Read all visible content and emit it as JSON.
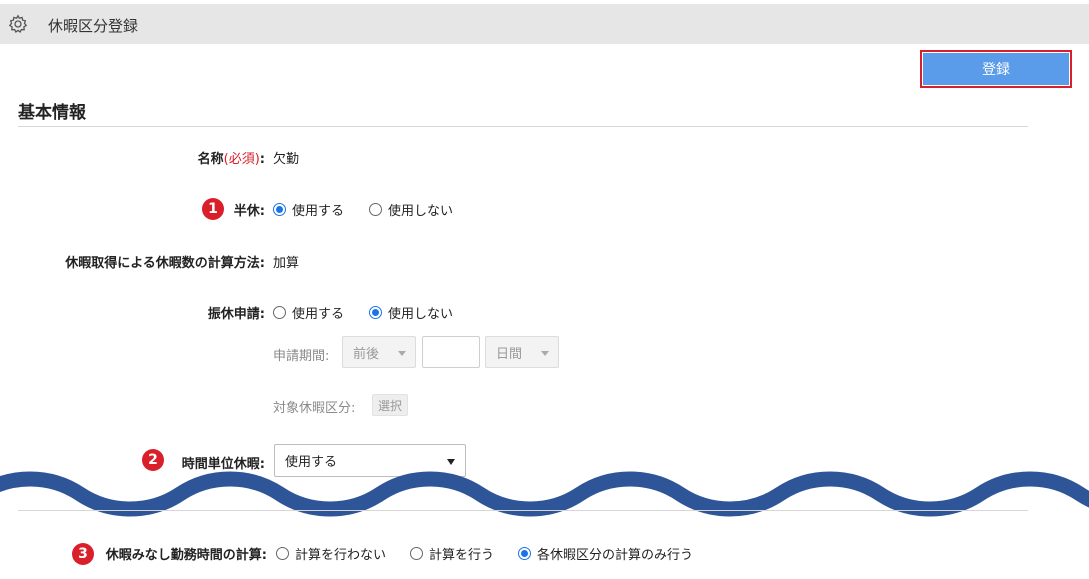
{
  "window": {
    "title": "休暇区分登録",
    "icon": "gear-icon"
  },
  "toolbar": {
    "register_label": "登録"
  },
  "section": {
    "title": "基本情報"
  },
  "fields": {
    "name": {
      "label": "名称",
      "required": "(必須)",
      "colon": ":",
      "value": "欠勤"
    },
    "half_day": {
      "badge": "1",
      "label": "半休:",
      "options": [
        {
          "label": "使用する",
          "selected": true
        },
        {
          "label": "使用しない",
          "selected": false
        }
      ]
    },
    "calc_method": {
      "label": "休暇取得による休暇数の計算方法:",
      "value": "加算"
    },
    "substitute": {
      "label": "振休申請:",
      "options": [
        {
          "label": "使用する",
          "selected": false
        },
        {
          "label": "使用しない",
          "selected": true
        }
      ],
      "period_label": "申請期間:",
      "period_select": "前後",
      "period_number": "",
      "period_unit": "日間",
      "target_label": "対象休暇区分:",
      "target_button": "選択"
    },
    "hourly": {
      "badge": "2",
      "label": "時間単位休暇:",
      "value": "使用する"
    },
    "deemed": {
      "badge": "3",
      "label": "休暇みなし勤務時間の計算:",
      "options": [
        {
          "label": "計算を行わない",
          "selected": false
        },
        {
          "label": "計算を行う",
          "selected": false
        },
        {
          "label": "各休暇区分の計算のみ行う",
          "selected": true
        }
      ]
    }
  },
  "colors": {
    "accent": "#5a9bea",
    "required": "#d9202a",
    "radio": "#1a73e8",
    "wave": "#2e5597"
  }
}
